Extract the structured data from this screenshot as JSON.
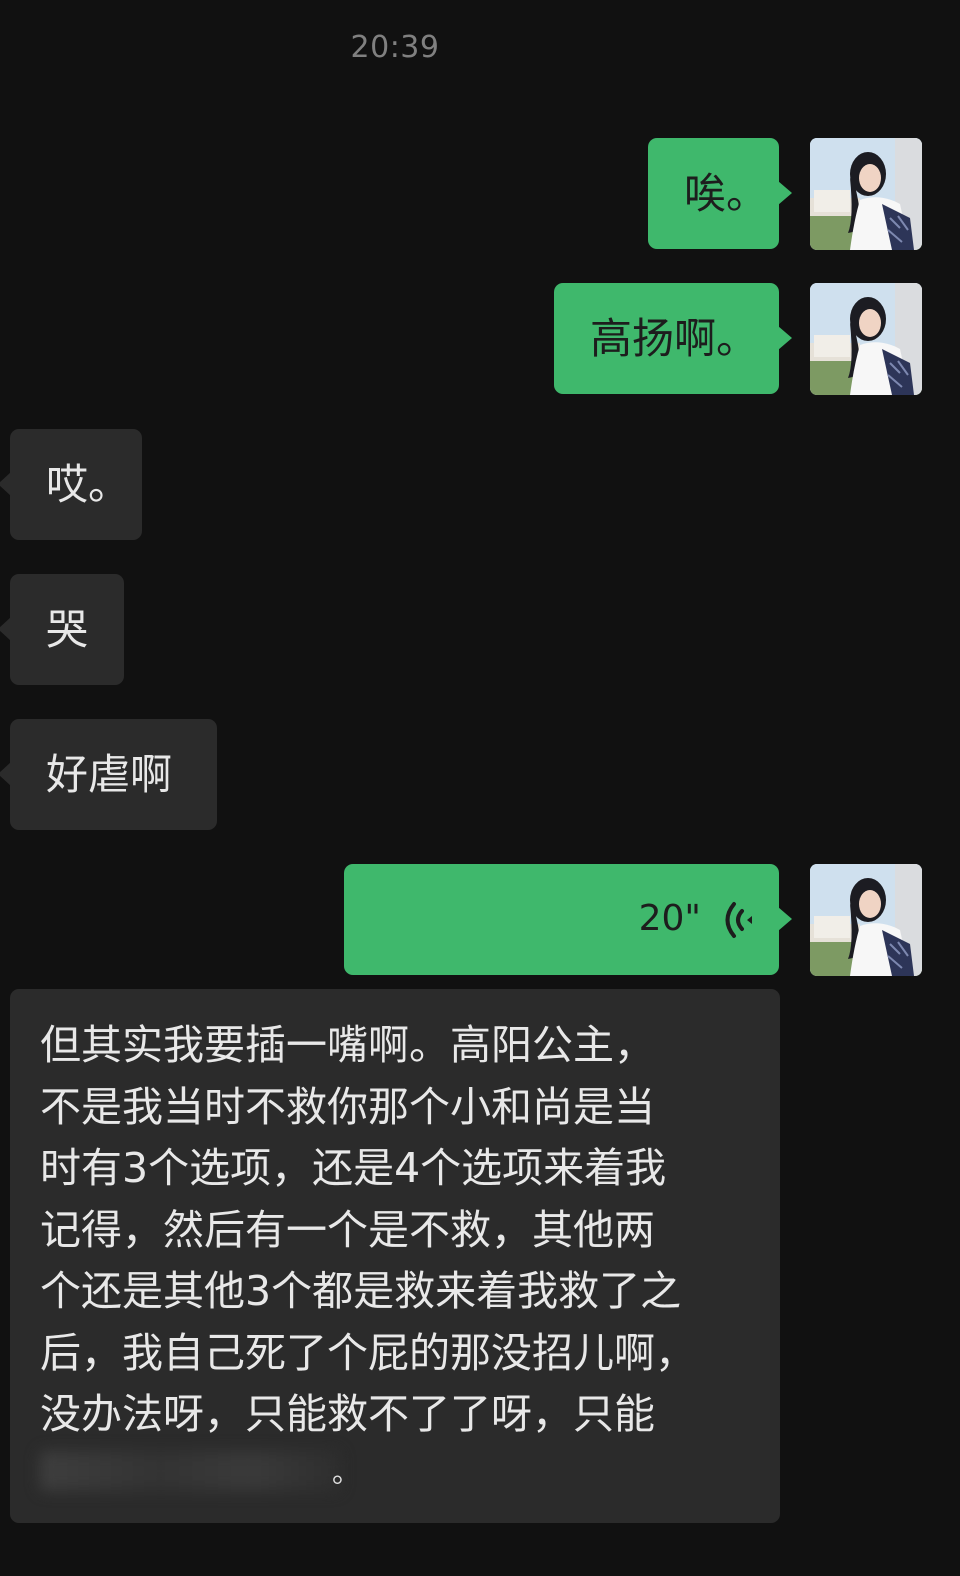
{
  "chat": {
    "timestamp": "20:39",
    "messages": [
      {
        "side": "sent",
        "type": "text",
        "text": "唉。"
      },
      {
        "side": "sent",
        "type": "text",
        "text": "高扬啊。"
      },
      {
        "side": "received",
        "type": "text",
        "text": "哎。"
      },
      {
        "side": "received",
        "type": "text",
        "text": "哭"
      },
      {
        "side": "received",
        "type": "text",
        "text": "好虐啊"
      },
      {
        "side": "sent",
        "type": "voice",
        "duration": "20\"",
        "icon": "voice-wave-icon"
      },
      {
        "side": "received",
        "type": "text",
        "text": "但其实我要插一嘴啊。高阳公主，\n不是我当时不救你那个小和尚是当\n时有3个选项，还是4个选项来着我\n记得，然后有一个是不救，其他两\n个还是其他3个都是救来着我救了之\n后，我自己死了个屁的那没招儿啊，\n没办法呀，只能救不了了呀，只能",
        "trailing": "。"
      }
    ]
  },
  "colors": {
    "background": "#111111",
    "sent_bubble": "#3fb86c",
    "received_bubble": "#2b2b2b",
    "timestamp": "#808080"
  }
}
